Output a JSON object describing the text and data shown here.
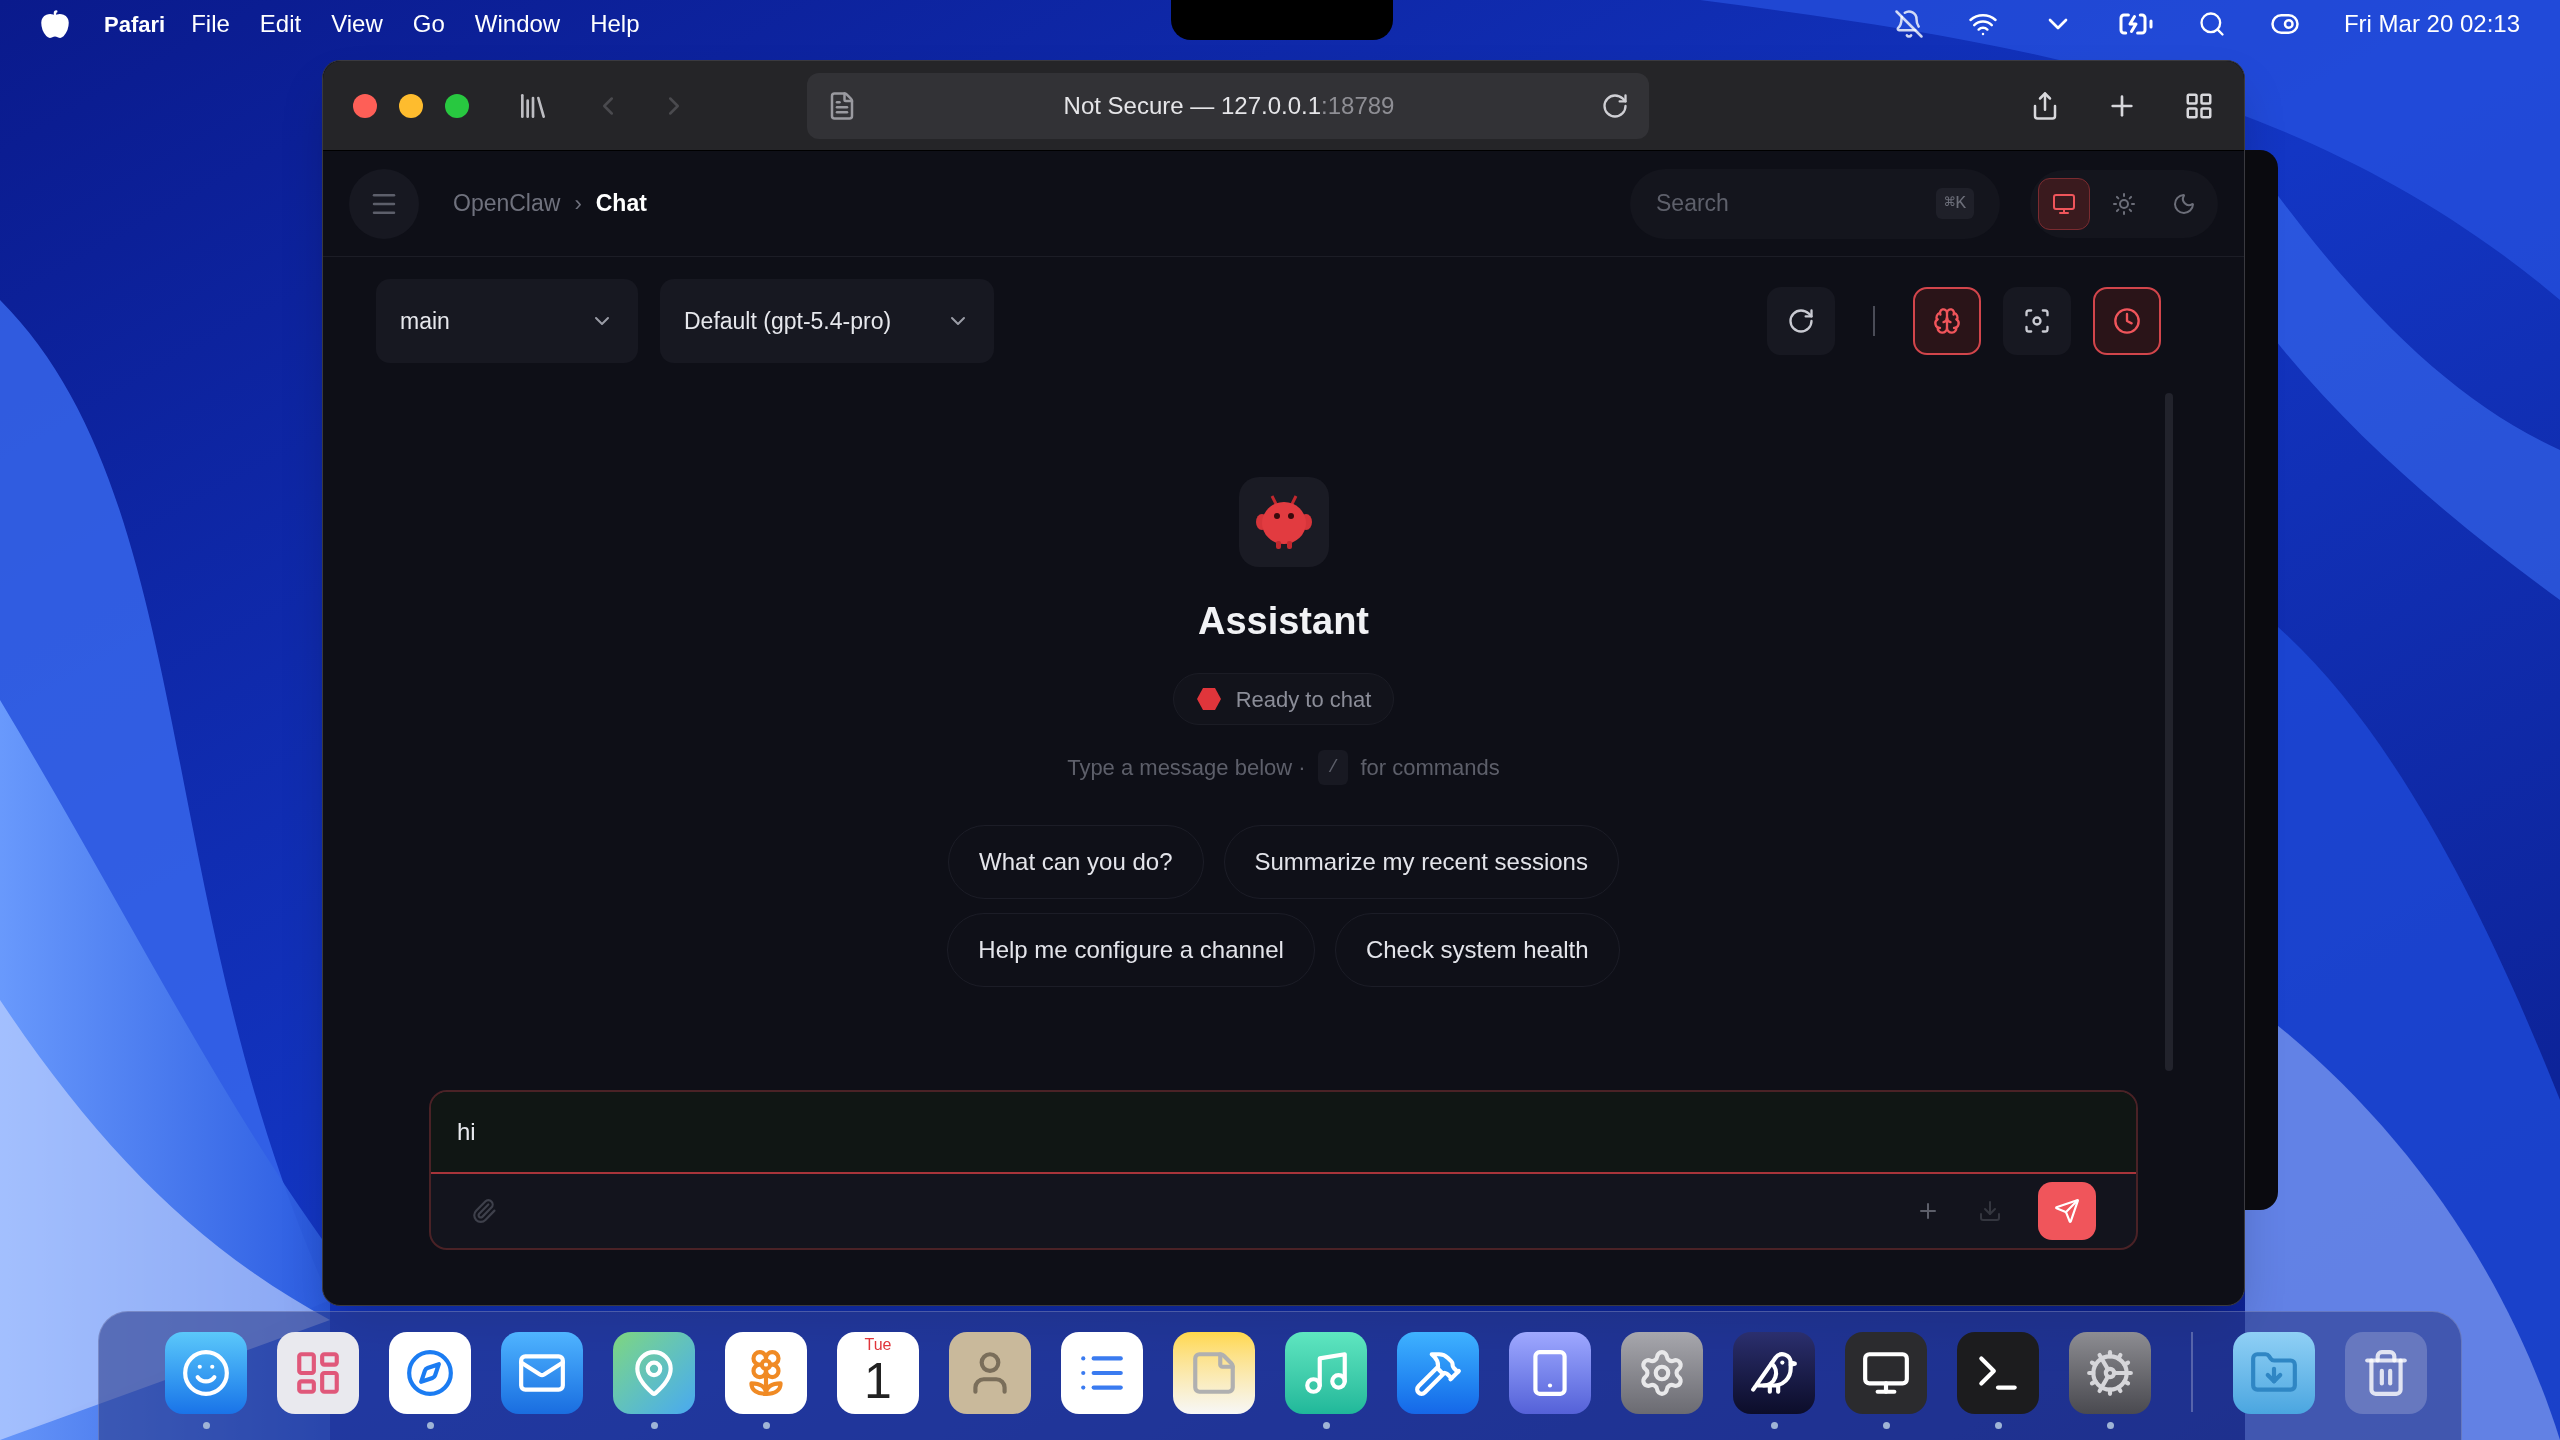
{
  "menu_bar": {
    "app": "Pafari",
    "menus": [
      "File",
      "Edit",
      "View",
      "Go",
      "Window",
      "Help"
    ],
    "clock": "Fri Mar 20 02:13"
  },
  "browser": {
    "back_enabled": false,
    "forward_enabled": false,
    "address": "Not Secure — 127.0.0.1",
    "port": ":18789"
  },
  "app_header": {
    "breadcrumb": [
      "OpenClaw",
      "Chat"
    ],
    "separator": "›",
    "search": {
      "placeholder": "Search",
      "shortcut": "⌘K"
    },
    "theme_options": [
      {
        "kind": "system",
        "selected": true
      },
      {
        "kind": "light",
        "selected": false
      },
      {
        "kind": "dark",
        "selected": false
      }
    ]
  },
  "controls": {
    "session": "main",
    "model": "Default (gpt-5.4-pro)",
    "tools": [
      {
        "kind": "refresh",
        "active": false
      },
      {
        "kind": "thinking",
        "active": true
      },
      {
        "kind": "focus",
        "active": false
      },
      {
        "kind": "schedule",
        "active": true
      }
    ]
  },
  "welcome": {
    "title": "Assistant",
    "status": "Ready to chat",
    "hint_before": "Type a message below ·",
    "hint_key": "/",
    "hint_after": "for commands",
    "suggestions": [
      [
        "What can you do?",
        "Summarize my recent sessions"
      ],
      [
        "Help me configure a channel",
        "Check system health"
      ]
    ]
  },
  "composer": {
    "value": "hi"
  },
  "dock": [
    {
      "kind": "finder",
      "running": true
    },
    {
      "kind": "launchpad",
      "running": false
    },
    {
      "kind": "safari",
      "running": true
    },
    {
      "kind": "mail",
      "running": false
    },
    {
      "kind": "maps",
      "running": true
    },
    {
      "kind": "photos",
      "running": true
    },
    {
      "kind": "calendar",
      "running": false,
      "day": "Tue",
      "date": "1"
    },
    {
      "kind": "contacts",
      "running": false
    },
    {
      "kind": "reminders",
      "running": false
    },
    {
      "kind": "notes",
      "running": false
    },
    {
      "kind": "music",
      "running": true
    },
    {
      "kind": "appstore",
      "running": false
    },
    {
      "kind": "phone",
      "running": false
    },
    {
      "kind": "settings",
      "running": false
    },
    {
      "kind": "bird",
      "running": true
    },
    {
      "kind": "display",
      "running": true
    },
    {
      "kind": "terminal",
      "running": true
    },
    {
      "kind": "utility",
      "running": true
    },
    {
      "kind": "downloads",
      "running": false
    },
    {
      "kind": "trash",
      "running": false
    }
  ]
}
